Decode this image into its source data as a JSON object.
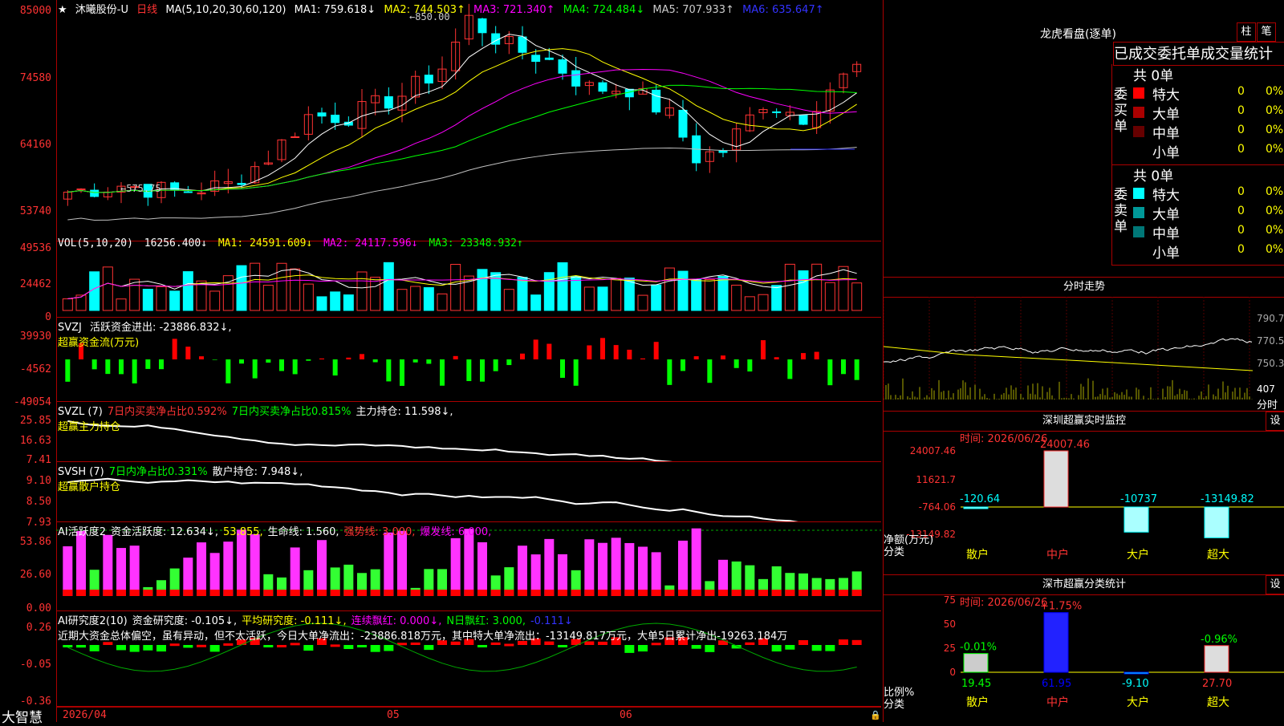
{
  "stock": {
    "name": "沐曦股份-U",
    "period": "日线",
    "ma_label": "MA(5,10,20,30,60,120)",
    "ma": [
      {
        "label": "MA1: 759.618↓",
        "color": "#ffffff"
      },
      {
        "label": "MA2: 744.503↑",
        "color": "#ffff00"
      },
      {
        "label": "MA3: 721.340↑",
        "color": "#ff00ff"
      },
      {
        "label": "MA4: 724.484↓",
        "color": "#00ff00"
      },
      {
        "label": "MA5: 707.933↑",
        "color": "#c0c0c0"
      },
      {
        "label": "MA6: 635.647↑",
        "color": "#3333ff"
      }
    ],
    "high_label": "850.00",
    "low_label": "575.75",
    "price_ticks": [
      "85000",
      "74580",
      "64160",
      "53740"
    ]
  },
  "vol": {
    "label": "VOL(5,10,20)",
    "value": "16256.400↓",
    "ma1": "MA1: 24591.609↓",
    "ma2": "MA2: 24117.596↓",
    "ma3": "MA3: 23348.932↑",
    "ticks": [
      "49536",
      "24462",
      "0"
    ]
  },
  "svzj": {
    "label": "SVZJ",
    "text": "活跃资金进出: -23886.832↓,",
    "sub": "超赢资金流(万元)",
    "ticks": [
      "39930",
      "-4562",
      "-49054"
    ]
  },
  "svzl": {
    "label": "SVZL (7)",
    "t1": "7日内买卖净占比0.592%",
    "t2": "7日内买卖净占比0.815%",
    "t3": "主力持仓: 11.598↓,",
    "sub": "超赢主力持仓",
    "ticks": [
      "25.85",
      "16.63",
      "7.41"
    ]
  },
  "svsh": {
    "label": "SVSH (7)",
    "t1": "7日内净占比0.331%",
    "t2": "散户持仓: 7.948↓,",
    "sub": "超赢散户持仓",
    "ticks": [
      "9.10",
      "8.50",
      "7.93"
    ]
  },
  "ai1": {
    "label": "AI活跃度2",
    "t1": "资金活跃度: 12.634↓,",
    "t2": "53.855,",
    "t3": "生命线: 1.560,",
    "t4": "强势线: 3.000,",
    "t5": "爆发线: 6.000,",
    "ticks": [
      "53.86",
      "26.60",
      "0.00"
    ]
  },
  "ai2": {
    "label": "AI研究度2(10)",
    "t1": "资金研究度: -0.105↓,",
    "t2": "平均研究度: -0.111↓,",
    "t3": "连续飘红: 0.000↓,",
    "t4": "N日飘红: 3.000,",
    "t5": "-0.111↓",
    "desc": "近期大资金总体偏空，虽有异动，但不太活跃，今日大单净流出：-23886.818万元，其中特大单净流出：-13149.817万元，大单5日累计净出-19263.184万",
    "ticks": [
      "0.26",
      "-0.05",
      "-0.36"
    ]
  },
  "dates": [
    "2026/04",
    "05",
    "06"
  ],
  "brand": "大智慧",
  "dragon": {
    "title": "龙虎看盘(逐单)",
    "btn1": "柱",
    "btn2": "笔",
    "tabs": [
      "已成交",
      "委托单",
      "成交量统计"
    ],
    "buy_title": "委买单",
    "sell_title": "委卖单",
    "count": "共 0单",
    "buy": [
      {
        "name": "特大",
        "v": "0",
        "p": "0%",
        "c": "#ff0000"
      },
      {
        "name": "大单",
        "v": "0",
        "p": "0%",
        "c": "#aa0000"
      },
      {
        "name": "中单",
        "v": "0",
        "p": "0%",
        "c": "#660000"
      },
      {
        "name": "小单",
        "v": "0",
        "p": "0%",
        "c": ""
      }
    ],
    "sell": [
      {
        "name": "特大",
        "v": "0",
        "p": "0%",
        "c": "#00ffff"
      },
      {
        "name": "大单",
        "v": "0",
        "p": "0%",
        "c": "#009999"
      },
      {
        "name": "中单",
        "v": "0",
        "p": "0%",
        "c": "#007777"
      },
      {
        "name": "小单",
        "v": "0",
        "p": "0%",
        "c": ""
      }
    ]
  },
  "intraday": {
    "title": "分时走势",
    "ticks": [
      "790.7",
      "770.5",
      "750.3"
    ],
    "vol": "407",
    "label": "分时"
  },
  "monitor": {
    "title": "深圳超赢实时监控",
    "btn": "设",
    "time": "时间: 2026/06/26",
    "ticks": [
      "24007.46",
      "11621.7",
      "-764.06",
      "-13149.82"
    ],
    "ylabel": "净额(万元)",
    "xlabel": "分类",
    "cats": [
      "散户",
      "中户",
      "大户",
      "超大"
    ],
    "vals": [
      "-120.64",
      "24007.46",
      "-10737",
      "-13149.82"
    ]
  },
  "classify": {
    "title": "深市超赢分类统计",
    "btn": "设",
    "time": "时间: 2026/06/26",
    "ticks": [
      "75",
      "50",
      "25",
      "0"
    ],
    "ylabel": "比例%",
    "xlabel": "分类",
    "cats": [
      "散户",
      "中户",
      "大户",
      "超大"
    ],
    "vals": [
      "19.45",
      "61.95",
      "-9.10",
      "27.70"
    ],
    "pcts": [
      "-0.01%",
      "+1.75%",
      "",
      "-0.96%"
    ]
  }
}
